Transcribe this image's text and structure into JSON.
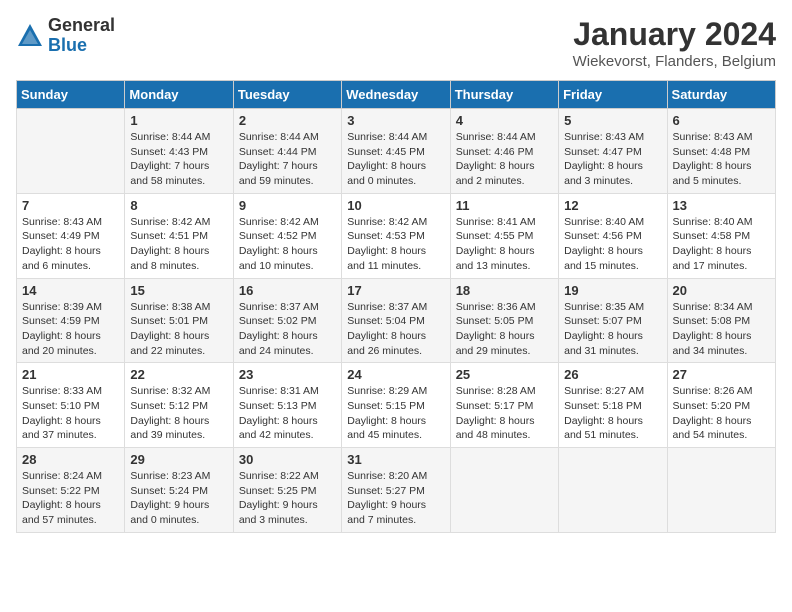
{
  "logo": {
    "general": "General",
    "blue": "Blue"
  },
  "header": {
    "month_year": "January 2024",
    "location": "Wiekevorst, Flanders, Belgium"
  },
  "weekdays": [
    "Sunday",
    "Monday",
    "Tuesday",
    "Wednesday",
    "Thursday",
    "Friday",
    "Saturday"
  ],
  "weeks": [
    [
      {
        "day": "",
        "info": ""
      },
      {
        "day": "1",
        "info": "Sunrise: 8:44 AM\nSunset: 4:43 PM\nDaylight: 7 hours\nand 58 minutes."
      },
      {
        "day": "2",
        "info": "Sunrise: 8:44 AM\nSunset: 4:44 PM\nDaylight: 7 hours\nand 59 minutes."
      },
      {
        "day": "3",
        "info": "Sunrise: 8:44 AM\nSunset: 4:45 PM\nDaylight: 8 hours\nand 0 minutes."
      },
      {
        "day": "4",
        "info": "Sunrise: 8:44 AM\nSunset: 4:46 PM\nDaylight: 8 hours\nand 2 minutes."
      },
      {
        "day": "5",
        "info": "Sunrise: 8:43 AM\nSunset: 4:47 PM\nDaylight: 8 hours\nand 3 minutes."
      },
      {
        "day": "6",
        "info": "Sunrise: 8:43 AM\nSunset: 4:48 PM\nDaylight: 8 hours\nand 5 minutes."
      }
    ],
    [
      {
        "day": "7",
        "info": "Sunrise: 8:43 AM\nSunset: 4:49 PM\nDaylight: 8 hours\nand 6 minutes."
      },
      {
        "day": "8",
        "info": "Sunrise: 8:42 AM\nSunset: 4:51 PM\nDaylight: 8 hours\nand 8 minutes."
      },
      {
        "day": "9",
        "info": "Sunrise: 8:42 AM\nSunset: 4:52 PM\nDaylight: 8 hours\nand 10 minutes."
      },
      {
        "day": "10",
        "info": "Sunrise: 8:42 AM\nSunset: 4:53 PM\nDaylight: 8 hours\nand 11 minutes."
      },
      {
        "day": "11",
        "info": "Sunrise: 8:41 AM\nSunset: 4:55 PM\nDaylight: 8 hours\nand 13 minutes."
      },
      {
        "day": "12",
        "info": "Sunrise: 8:40 AM\nSunset: 4:56 PM\nDaylight: 8 hours\nand 15 minutes."
      },
      {
        "day": "13",
        "info": "Sunrise: 8:40 AM\nSunset: 4:58 PM\nDaylight: 8 hours\nand 17 minutes."
      }
    ],
    [
      {
        "day": "14",
        "info": "Sunrise: 8:39 AM\nSunset: 4:59 PM\nDaylight: 8 hours\nand 20 minutes."
      },
      {
        "day": "15",
        "info": "Sunrise: 8:38 AM\nSunset: 5:01 PM\nDaylight: 8 hours\nand 22 minutes."
      },
      {
        "day": "16",
        "info": "Sunrise: 8:37 AM\nSunset: 5:02 PM\nDaylight: 8 hours\nand 24 minutes."
      },
      {
        "day": "17",
        "info": "Sunrise: 8:37 AM\nSunset: 5:04 PM\nDaylight: 8 hours\nand 26 minutes."
      },
      {
        "day": "18",
        "info": "Sunrise: 8:36 AM\nSunset: 5:05 PM\nDaylight: 8 hours\nand 29 minutes."
      },
      {
        "day": "19",
        "info": "Sunrise: 8:35 AM\nSunset: 5:07 PM\nDaylight: 8 hours\nand 31 minutes."
      },
      {
        "day": "20",
        "info": "Sunrise: 8:34 AM\nSunset: 5:08 PM\nDaylight: 8 hours\nand 34 minutes."
      }
    ],
    [
      {
        "day": "21",
        "info": "Sunrise: 8:33 AM\nSunset: 5:10 PM\nDaylight: 8 hours\nand 37 minutes."
      },
      {
        "day": "22",
        "info": "Sunrise: 8:32 AM\nSunset: 5:12 PM\nDaylight: 8 hours\nand 39 minutes."
      },
      {
        "day": "23",
        "info": "Sunrise: 8:31 AM\nSunset: 5:13 PM\nDaylight: 8 hours\nand 42 minutes."
      },
      {
        "day": "24",
        "info": "Sunrise: 8:29 AM\nSunset: 5:15 PM\nDaylight: 8 hours\nand 45 minutes."
      },
      {
        "day": "25",
        "info": "Sunrise: 8:28 AM\nSunset: 5:17 PM\nDaylight: 8 hours\nand 48 minutes."
      },
      {
        "day": "26",
        "info": "Sunrise: 8:27 AM\nSunset: 5:18 PM\nDaylight: 8 hours\nand 51 minutes."
      },
      {
        "day": "27",
        "info": "Sunrise: 8:26 AM\nSunset: 5:20 PM\nDaylight: 8 hours\nand 54 minutes."
      }
    ],
    [
      {
        "day": "28",
        "info": "Sunrise: 8:24 AM\nSunset: 5:22 PM\nDaylight: 8 hours\nand 57 minutes."
      },
      {
        "day": "29",
        "info": "Sunrise: 8:23 AM\nSunset: 5:24 PM\nDaylight: 9 hours\nand 0 minutes."
      },
      {
        "day": "30",
        "info": "Sunrise: 8:22 AM\nSunset: 5:25 PM\nDaylight: 9 hours\nand 3 minutes."
      },
      {
        "day": "31",
        "info": "Sunrise: 8:20 AM\nSunset: 5:27 PM\nDaylight: 9 hours\nand 7 minutes."
      },
      {
        "day": "",
        "info": ""
      },
      {
        "day": "",
        "info": ""
      },
      {
        "day": "",
        "info": ""
      }
    ]
  ]
}
